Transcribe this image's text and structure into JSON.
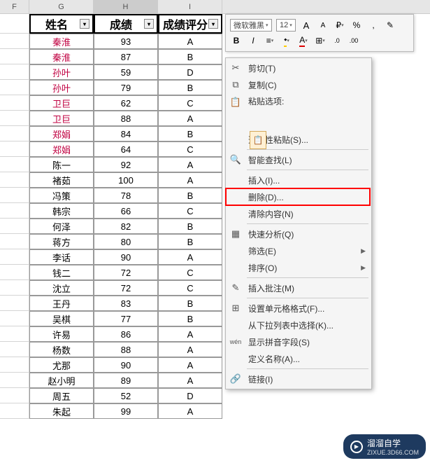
{
  "columns": {
    "f": "F",
    "g": "G",
    "h": "H",
    "i": "I"
  },
  "headers": {
    "name": "姓名",
    "score": "成绩",
    "grade": "成绩评分"
  },
  "rows": [
    {
      "name": "秦淮",
      "score": "93",
      "grade": "A",
      "pink": true,
      "selected": false
    },
    {
      "name": "秦淮",
      "score": "87",
      "grade": "B",
      "pink": true,
      "selected": true
    },
    {
      "name": "孙叶",
      "score": "59",
      "grade": "D",
      "pink": true,
      "selected": false
    },
    {
      "name": "孙叶",
      "score": "79",
      "grade": "B",
      "pink": true,
      "selected": false
    },
    {
      "name": "卫巨",
      "score": "62",
      "grade": "C",
      "pink": true,
      "selected": false
    },
    {
      "name": "卫巨",
      "score": "88",
      "grade": "A",
      "pink": true,
      "selected": false
    },
    {
      "name": "郑娟",
      "score": "84",
      "grade": "B",
      "pink": true,
      "selected": false
    },
    {
      "name": "郑娟",
      "score": "64",
      "grade": "C",
      "pink": true,
      "selected": false
    },
    {
      "name": "陈一",
      "score": "92",
      "grade": "A",
      "pink": false,
      "selected": false
    },
    {
      "name": "褚茹",
      "score": "100",
      "grade": "A",
      "pink": false,
      "selected": false
    },
    {
      "name": "冯策",
      "score": "78",
      "grade": "B",
      "pink": false,
      "selected": false
    },
    {
      "name": "韩宗",
      "score": "66",
      "grade": "C",
      "pink": false,
      "selected": false
    },
    {
      "name": "何泽",
      "score": "82",
      "grade": "B",
      "pink": false,
      "selected": false
    },
    {
      "name": "蒋方",
      "score": "80",
      "grade": "B",
      "pink": false,
      "selected": false
    },
    {
      "name": "李话",
      "score": "90",
      "grade": "A",
      "pink": false,
      "selected": false
    },
    {
      "name": "钱二",
      "score": "72",
      "grade": "C",
      "pink": false,
      "selected": false
    },
    {
      "name": "沈立",
      "score": "72",
      "grade": "C",
      "pink": false,
      "selected": false
    },
    {
      "name": "王丹",
      "score": "83",
      "grade": "B",
      "pink": false,
      "selected": false
    },
    {
      "name": "吴棋",
      "score": "77",
      "grade": "B",
      "pink": false,
      "selected": false
    },
    {
      "name": "许易",
      "score": "86",
      "grade": "A",
      "pink": false,
      "selected": false
    },
    {
      "name": "杨数",
      "score": "88",
      "grade": "A",
      "pink": false,
      "selected": false
    },
    {
      "name": "尤那",
      "score": "90",
      "grade": "A",
      "pink": false,
      "selected": false
    },
    {
      "name": "赵小明",
      "score": "89",
      "grade": "A",
      "pink": false,
      "selected": false
    },
    {
      "name": "周五",
      "score": "52",
      "grade": "D",
      "pink": false,
      "selected": false
    },
    {
      "name": "朱起",
      "score": "99",
      "grade": "A",
      "pink": false,
      "selected": false
    }
  ],
  "toolbar": {
    "font": "微软雅黑",
    "size": "12",
    "bold": "B",
    "italic": "I",
    "percent": "%",
    "comma": ",",
    "font_a_big": "A",
    "font_a_small": "A",
    "font_color": "A",
    "fill": "⬩",
    "align": "≡",
    "border": "⊞",
    "inc_dec_1": ".0",
    "inc_dec_2": ".00",
    "fmt": "✎"
  },
  "menu": {
    "cut": "剪切(T)",
    "copy": "复制(C)",
    "paste_options": "粘贴选项:",
    "paste_special": "选择性粘贴(S)...",
    "smart_find": "智能查找(L)",
    "insert": "插入(I)...",
    "delete": "删除(D)...",
    "clear": "清除内容(N)",
    "quick_analysis": "快速分析(Q)",
    "filter": "筛选(E)",
    "sort": "排序(O)",
    "insert_comment": "插入批注(M)",
    "format_cells": "设置单元格格式(F)...",
    "dropdown_list": "从下拉列表中选择(K)...",
    "show_pinyin": "显示拼音字段(S)",
    "define_name": "定义名称(A)...",
    "hyperlink": "链接(I)"
  },
  "watermark": {
    "title": "溜溜自学",
    "sub": "ZIXUE.3D66.COM"
  }
}
